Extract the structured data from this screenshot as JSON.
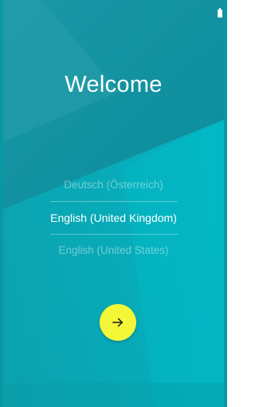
{
  "welcome": {
    "title": "Welcome"
  },
  "languages": {
    "items": [
      {
        "label": "Deutsch (Österreich)",
        "state": "unselected"
      },
      {
        "label": "English (United Kingdom)",
        "state": "selected"
      },
      {
        "label": "English (United States)",
        "state": "unselected"
      }
    ]
  },
  "next_button": {
    "icon": "arrow-right-icon",
    "color": "#f4f738"
  },
  "status_bar": {
    "icon": "battery-icon"
  },
  "colors": {
    "background": "#0a97a4",
    "accent": "#f4f738"
  }
}
